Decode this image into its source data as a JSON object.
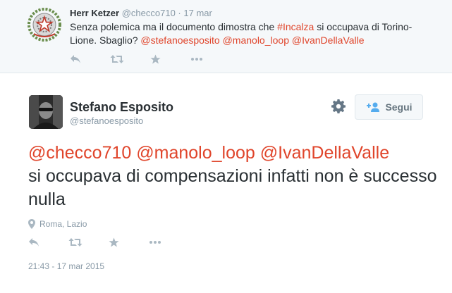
{
  "reply": {
    "name": "Herr Ketzer",
    "handle": "@checco710",
    "separator": "·",
    "time": "17 mar",
    "text_before": "Senza polemica ma il documento dimostra che ",
    "hashtag": "#Incalza",
    "text_after": " si occupava di Torino-Lione. Sbaglio? ",
    "mentions": [
      "@stefanoesposito",
      "@manolo_loop",
      "@IvanDellaValle"
    ],
    "actions": [
      "reply-icon",
      "retweet-icon",
      "favorite-icon",
      "more-icon"
    ]
  },
  "tweet": {
    "name": "Stefano Esposito",
    "handle": "@stefanoesposito",
    "follow_label": "Segui",
    "mentions": [
      "@checco710",
      "@manolo_loop",
      "@IvanDellaValle"
    ],
    "text": "si occupava di compensazioni infatti non è successo nulla",
    "location": "Roma, Lazio",
    "actions": [
      "reply-icon",
      "retweet-icon",
      "favorite-icon",
      "more-icon"
    ],
    "timestamp": "21:43 - 17 mar 2015"
  },
  "colors": {
    "link": "#e0452b",
    "muted": "#8899a6",
    "icon": "#aab8c2",
    "reply_background": "#f5f8fa"
  }
}
